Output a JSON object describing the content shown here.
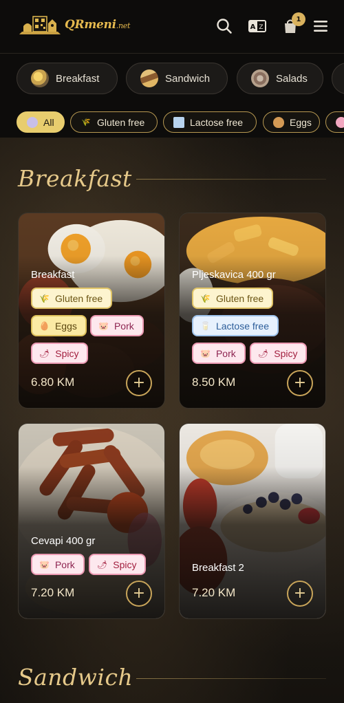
{
  "header": {
    "logo_text": "QRmeni",
    "logo_suffix": ".net",
    "icons": [
      "search-icon",
      "translate-icon",
      "cart-icon",
      "menu-icon"
    ],
    "cart_count": "1"
  },
  "categories": [
    {
      "label": "Breakfast"
    },
    {
      "label": "Sandwich"
    },
    {
      "label": "Salads"
    }
  ],
  "filters": [
    {
      "label": "All",
      "active": true
    },
    {
      "label": "Gluten free",
      "active": false
    },
    {
      "label": "Lactose free",
      "active": false
    },
    {
      "label": "Eggs",
      "active": false
    }
  ],
  "sections": [
    {
      "title": "Breakfast",
      "items": [
        {
          "name": "Breakfast",
          "tags": [
            "Gluten free",
            "Eggs",
            "Pork",
            "Spicy"
          ],
          "price": "6.80 KM"
        },
        {
          "name": "Pljeskavica 400 gr",
          "tags": [
            "Gluten free",
            "Lactose free",
            "Pork",
            "Spicy"
          ],
          "price": "8.50 KM"
        },
        {
          "name": "Cevapi 400 gr",
          "tags": [
            "Pork",
            "Spicy"
          ],
          "price": "7.20 KM"
        },
        {
          "name": "Breakfast 2",
          "tags": [],
          "price": "7.20 KM"
        }
      ]
    },
    {
      "title": "Sandwich"
    }
  ],
  "colors": {
    "accent_gold": "#e6c98a",
    "active_filter": "#e8cd6e",
    "header_bg": "#0d0c0b"
  }
}
